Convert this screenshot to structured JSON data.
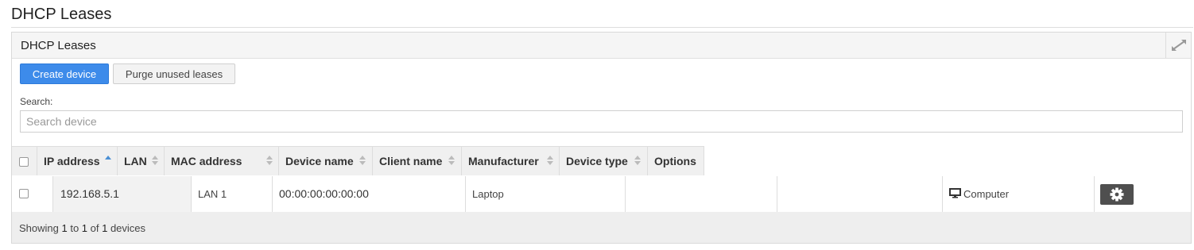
{
  "page": {
    "title": "DHCP Leases"
  },
  "panel": {
    "title": "DHCP Leases",
    "expand_icon": "expand-arrows-icon"
  },
  "toolbar": {
    "create_label": "Create device",
    "purge_label": "Purge unused leases"
  },
  "search": {
    "label": "Search:",
    "placeholder": "Search device",
    "value": ""
  },
  "table": {
    "columns": [
      "IP address",
      "LAN",
      "MAC address",
      "Device name",
      "Client name",
      "Manufacturer",
      "Device type",
      "Options"
    ],
    "sorted_column": "IP address",
    "sort_direction": "ascending",
    "rows": [
      {
        "ip": "192.168.5.1",
        "lan": "LAN 1",
        "mac": "00:00:00:00:00:00",
        "device_name": "Laptop",
        "client_name": "",
        "manufacturer": "",
        "device_type": "Computer",
        "device_type_icon": "monitor-icon",
        "options_icon": "gear-icon"
      }
    ]
  },
  "footer": {
    "prefix": "Showing ",
    "from": "1",
    "to_word": " to ",
    "to": "1",
    "of_word": " of ",
    "total": "1",
    "suffix": " devices"
  },
  "colors": {
    "primary": "#3d8bea",
    "gear_button": "#4f4f4f",
    "sort_active": "#4a8fd4"
  }
}
